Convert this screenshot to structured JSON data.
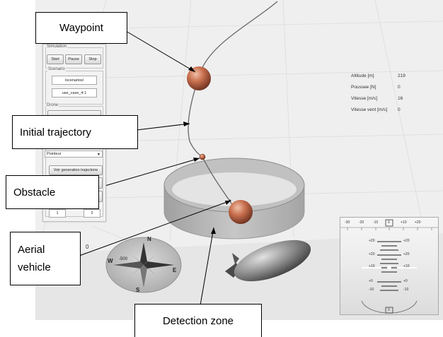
{
  "callouts": {
    "waypoint": "Waypoint",
    "initial_trajectory": "Initial trajectory",
    "obstacle": "Obstacle",
    "aerial_vehicle_line1": "Aerial",
    "aerial_vehicle_line2": "vehicle",
    "detection_zone": "Detection zone"
  },
  "control_panel": {
    "simulation_group": "Simulation",
    "start_button": "Start",
    "pause_button": "Pause",
    "stop_button": "Stop",
    "scenario_group": "Scenario",
    "scenario_path": "/scenarios/",
    "scenario_file": "use_case_4-1",
    "drone_group": "Drone",
    "mode_select": "Pointeur",
    "trajectory_button": "Voir generation trajectoire",
    "field_a": "1",
    "field_b": "2"
  },
  "telemetry": [
    {
      "label": "Altitude [m]",
      "value": "219"
    },
    {
      "label": "Poussee [N]",
      "value": "0"
    },
    {
      "label": "Vitesse [m/s]",
      "value": "16"
    },
    {
      "label": "Vitesse vent [m/s]",
      "value": "0"
    }
  ],
  "compass": {
    "n": "N",
    "s": "S",
    "e": "E",
    "w": "W",
    "scale": "-500"
  },
  "axis_origin": "0",
  "hud": {
    "heading_ticks": [
      "-30",
      "-20",
      "-10",
      "0",
      "+10",
      "+20"
    ],
    "pitch_left": [
      "+20",
      "+20",
      "+10",
      "+0",
      "-10"
    ],
    "pitch_right": [
      "+20",
      "+20",
      "+10",
      "+0",
      "-10"
    ],
    "roll_value": "0"
  },
  "colors": {
    "sphere": "#c9704f",
    "zone": "#bdbdbd",
    "blimp": "#8a8a8a"
  }
}
